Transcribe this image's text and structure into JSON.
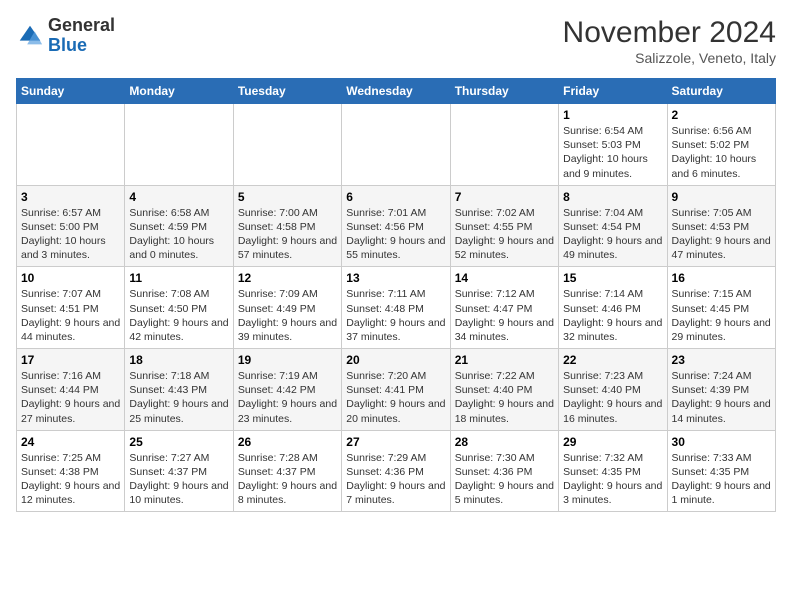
{
  "logo": {
    "general": "General",
    "blue": "Blue"
  },
  "header": {
    "month": "November 2024",
    "location": "Salizzole, Veneto, Italy"
  },
  "days_of_week": [
    "Sunday",
    "Monday",
    "Tuesday",
    "Wednesday",
    "Thursday",
    "Friday",
    "Saturday"
  ],
  "weeks": [
    [
      {
        "day": "",
        "info": ""
      },
      {
        "day": "",
        "info": ""
      },
      {
        "day": "",
        "info": ""
      },
      {
        "day": "",
        "info": ""
      },
      {
        "day": "",
        "info": ""
      },
      {
        "day": "1",
        "info": "Sunrise: 6:54 AM\nSunset: 5:03 PM\nDaylight: 10 hours and 9 minutes."
      },
      {
        "day": "2",
        "info": "Sunrise: 6:56 AM\nSunset: 5:02 PM\nDaylight: 10 hours and 6 minutes."
      }
    ],
    [
      {
        "day": "3",
        "info": "Sunrise: 6:57 AM\nSunset: 5:00 PM\nDaylight: 10 hours and 3 minutes."
      },
      {
        "day": "4",
        "info": "Sunrise: 6:58 AM\nSunset: 4:59 PM\nDaylight: 10 hours and 0 minutes."
      },
      {
        "day": "5",
        "info": "Sunrise: 7:00 AM\nSunset: 4:58 PM\nDaylight: 9 hours and 57 minutes."
      },
      {
        "day": "6",
        "info": "Sunrise: 7:01 AM\nSunset: 4:56 PM\nDaylight: 9 hours and 55 minutes."
      },
      {
        "day": "7",
        "info": "Sunrise: 7:02 AM\nSunset: 4:55 PM\nDaylight: 9 hours and 52 minutes."
      },
      {
        "day": "8",
        "info": "Sunrise: 7:04 AM\nSunset: 4:54 PM\nDaylight: 9 hours and 49 minutes."
      },
      {
        "day": "9",
        "info": "Sunrise: 7:05 AM\nSunset: 4:53 PM\nDaylight: 9 hours and 47 minutes."
      }
    ],
    [
      {
        "day": "10",
        "info": "Sunrise: 7:07 AM\nSunset: 4:51 PM\nDaylight: 9 hours and 44 minutes."
      },
      {
        "day": "11",
        "info": "Sunrise: 7:08 AM\nSunset: 4:50 PM\nDaylight: 9 hours and 42 minutes."
      },
      {
        "day": "12",
        "info": "Sunrise: 7:09 AM\nSunset: 4:49 PM\nDaylight: 9 hours and 39 minutes."
      },
      {
        "day": "13",
        "info": "Sunrise: 7:11 AM\nSunset: 4:48 PM\nDaylight: 9 hours and 37 minutes."
      },
      {
        "day": "14",
        "info": "Sunrise: 7:12 AM\nSunset: 4:47 PM\nDaylight: 9 hours and 34 minutes."
      },
      {
        "day": "15",
        "info": "Sunrise: 7:14 AM\nSunset: 4:46 PM\nDaylight: 9 hours and 32 minutes."
      },
      {
        "day": "16",
        "info": "Sunrise: 7:15 AM\nSunset: 4:45 PM\nDaylight: 9 hours and 29 minutes."
      }
    ],
    [
      {
        "day": "17",
        "info": "Sunrise: 7:16 AM\nSunset: 4:44 PM\nDaylight: 9 hours and 27 minutes."
      },
      {
        "day": "18",
        "info": "Sunrise: 7:18 AM\nSunset: 4:43 PM\nDaylight: 9 hours and 25 minutes."
      },
      {
        "day": "19",
        "info": "Sunrise: 7:19 AM\nSunset: 4:42 PM\nDaylight: 9 hours and 23 minutes."
      },
      {
        "day": "20",
        "info": "Sunrise: 7:20 AM\nSunset: 4:41 PM\nDaylight: 9 hours and 20 minutes."
      },
      {
        "day": "21",
        "info": "Sunrise: 7:22 AM\nSunset: 4:40 PM\nDaylight: 9 hours and 18 minutes."
      },
      {
        "day": "22",
        "info": "Sunrise: 7:23 AM\nSunset: 4:40 PM\nDaylight: 9 hours and 16 minutes."
      },
      {
        "day": "23",
        "info": "Sunrise: 7:24 AM\nSunset: 4:39 PM\nDaylight: 9 hours and 14 minutes."
      }
    ],
    [
      {
        "day": "24",
        "info": "Sunrise: 7:25 AM\nSunset: 4:38 PM\nDaylight: 9 hours and 12 minutes."
      },
      {
        "day": "25",
        "info": "Sunrise: 7:27 AM\nSunset: 4:37 PM\nDaylight: 9 hours and 10 minutes."
      },
      {
        "day": "26",
        "info": "Sunrise: 7:28 AM\nSunset: 4:37 PM\nDaylight: 9 hours and 8 minutes."
      },
      {
        "day": "27",
        "info": "Sunrise: 7:29 AM\nSunset: 4:36 PM\nDaylight: 9 hours and 7 minutes."
      },
      {
        "day": "28",
        "info": "Sunrise: 7:30 AM\nSunset: 4:36 PM\nDaylight: 9 hours and 5 minutes."
      },
      {
        "day": "29",
        "info": "Sunrise: 7:32 AM\nSunset: 4:35 PM\nDaylight: 9 hours and 3 minutes."
      },
      {
        "day": "30",
        "info": "Sunrise: 7:33 AM\nSunset: 4:35 PM\nDaylight: 9 hours and 1 minute."
      }
    ]
  ]
}
